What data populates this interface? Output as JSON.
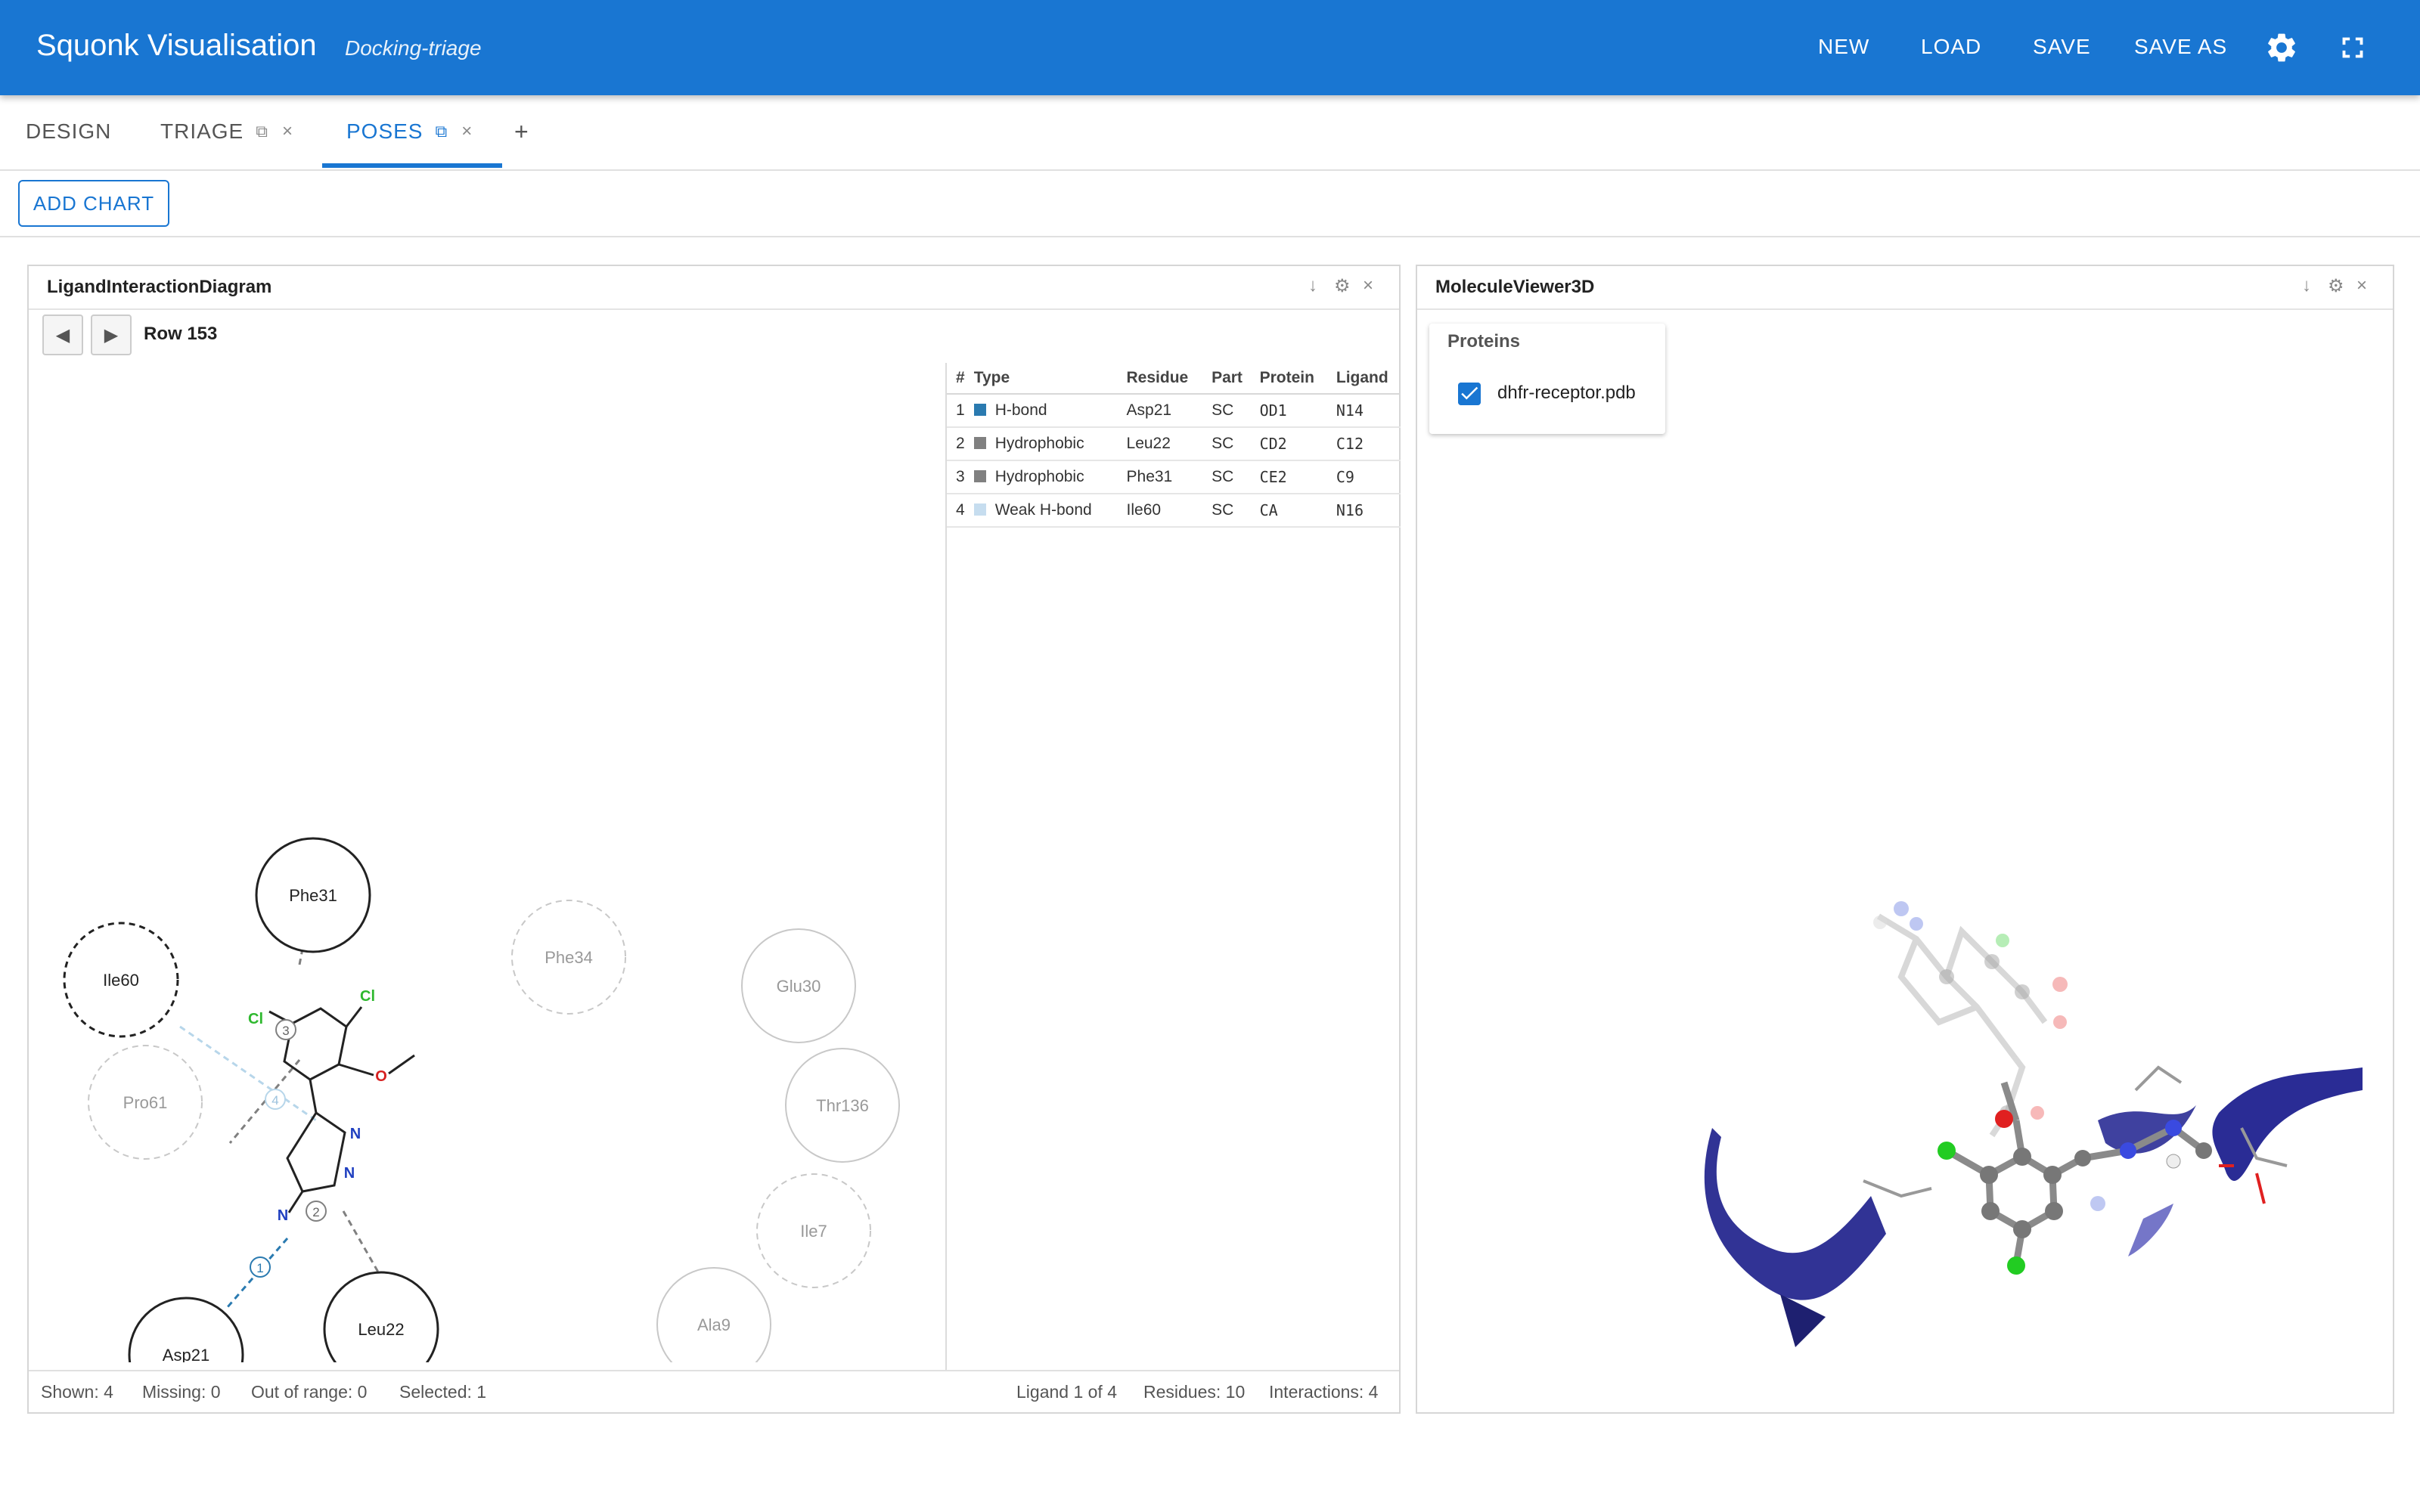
{
  "app": {
    "title": "Squonk Visualisation",
    "subtitle": "Docking-triage",
    "actions": [
      "NEW",
      "LOAD",
      "SAVE",
      "SAVE AS"
    ],
    "icons": [
      "settings-gear-icon",
      "fullscreen-icon"
    ],
    "accent_color": "#1976d2"
  },
  "tabs": [
    {
      "label": "DESIGN",
      "active": false
    },
    {
      "label": "TRIAGE",
      "active": false
    },
    {
      "label": "POSES",
      "active": true
    }
  ],
  "toolbar": {
    "add_chart_label": "ADD CHART",
    "add_tab_symbol": "+"
  },
  "lid_panel": {
    "title": "LigandInteractionDiagram",
    "row_label": "Row 153",
    "nav_prev": "◀",
    "nav_next": "▶",
    "residues": [
      {
        "name": "Phe31",
        "style": "solid"
      },
      {
        "name": "Ile60",
        "style": "dashed-dark"
      },
      {
        "name": "Pro61",
        "style": "faded"
      },
      {
        "name": "Phe34",
        "style": "faded"
      },
      {
        "name": "Glu30",
        "style": "light"
      },
      {
        "name": "Thr136",
        "style": "light"
      },
      {
        "name": "Ile7",
        "style": "faded"
      },
      {
        "name": "Ala9",
        "style": "light"
      },
      {
        "name": "Asp21",
        "style": "solid"
      },
      {
        "name": "Leu22",
        "style": "solid"
      }
    ],
    "atom_labels": {
      "cl1": "Cl",
      "cl2": "Cl",
      "o": "O",
      "n1": "N",
      "n2": "N",
      "n3": "N"
    },
    "interaction_markers": [
      "1",
      "2",
      "3",
      "4"
    ],
    "table": {
      "columns": [
        "#",
        "Type",
        "Residue",
        "Part",
        "Protein",
        "Ligand"
      ],
      "rows": [
        {
          "num": "1",
          "type": "H-bond",
          "color": "#2a7ab0",
          "residue": "Asp21",
          "part": "SC",
          "protein": "OD1",
          "ligand": "N14"
        },
        {
          "num": "2",
          "type": "Hydrophobic",
          "color": "#808080",
          "residue": "Leu22",
          "part": "SC",
          "protein": "CD2",
          "ligand": "C12"
        },
        {
          "num": "3",
          "type": "Hydrophobic",
          "color": "#808080",
          "residue": "Phe31",
          "part": "SC",
          "protein": "CE2",
          "ligand": "C9"
        },
        {
          "num": "4",
          "type": "Weak H-bond",
          "color": "#c6ddef",
          "residue": "Ile60",
          "part": "SC",
          "protein": "CA",
          "ligand": "N16"
        }
      ]
    },
    "footer_left": [
      "Shown: 4",
      "Missing: 0",
      "Out of range: 0",
      "Selected: 1"
    ],
    "footer_right": [
      "Ligand 1 of 4",
      "Residues: 10",
      "Interactions: 4"
    ]
  },
  "mv_panel": {
    "title": "MoleculeViewer3D",
    "proteins_title": "Proteins",
    "protein_file": "dhfr-receptor.pdb",
    "protein_checked": true
  },
  "panel_icons": [
    "download-icon",
    "gear-icon",
    "close-icon"
  ]
}
